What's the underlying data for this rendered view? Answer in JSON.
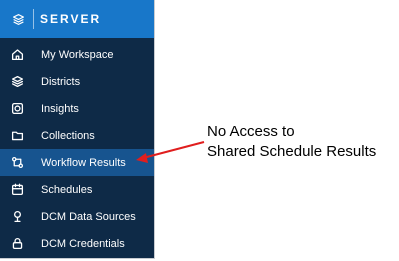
{
  "brand": {
    "title": "SERVER",
    "logo_icon": "layers-logo-icon",
    "color": "#1877c9"
  },
  "sidebar": {
    "background": "#0e2a47",
    "active_background": "#17548f",
    "items": [
      {
        "label": "My Workspace",
        "icon": "home-icon"
      },
      {
        "label": "Districts",
        "icon": "layers-icon"
      },
      {
        "label": "Insights",
        "icon": "insights-icon"
      },
      {
        "label": "Collections",
        "icon": "folder-icon"
      },
      {
        "label": "Workflow Results",
        "icon": "workflow-icon",
        "active": true
      },
      {
        "label": "Schedules",
        "icon": "calendar-icon"
      },
      {
        "label": "DCM Data Sources",
        "icon": "data-source-icon"
      },
      {
        "label": "DCM Credentials",
        "icon": "lock-icon"
      }
    ]
  },
  "annotation": {
    "line1": "No Access to",
    "line2": "Shared Schedule Results",
    "arrow_color": "#e01e1e"
  }
}
